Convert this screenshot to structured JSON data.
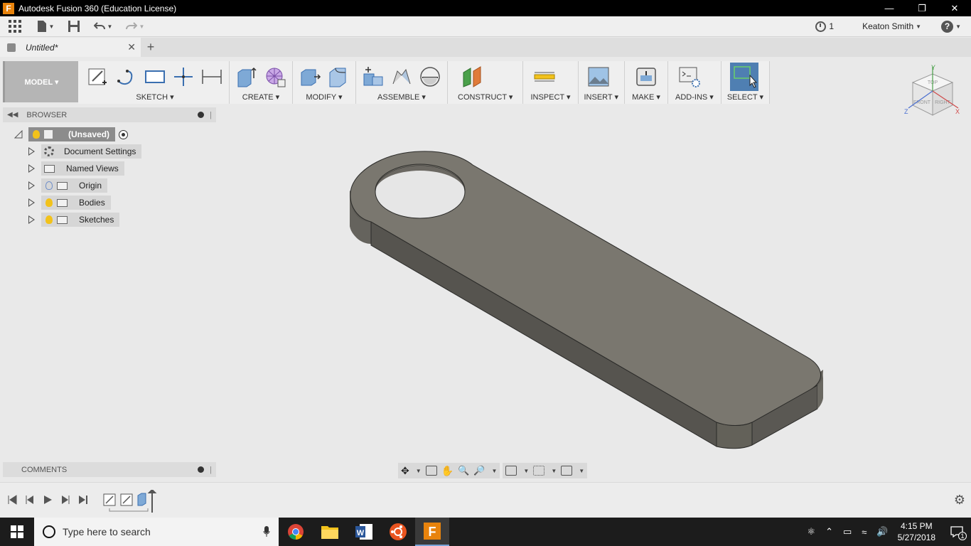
{
  "window": {
    "title": "Autodesk Fusion 360 (Education License)",
    "app_icon": "F"
  },
  "quick_access": {
    "job_count": "1",
    "user": "Keaton Smith",
    "help": "?"
  },
  "tabs": {
    "doc_title": "Untitled*"
  },
  "toolbar": {
    "workspace": "MODEL ▾",
    "groups": [
      {
        "label": "SKETCH ▾"
      },
      {
        "label": "CREATE ▾"
      },
      {
        "label": "MODIFY ▾"
      },
      {
        "label": "ASSEMBLE ▾"
      },
      {
        "label": "CONSTRUCT ▾"
      },
      {
        "label": "INSPECT ▾"
      },
      {
        "label": "INSERT ▾"
      },
      {
        "label": "MAKE ▾"
      },
      {
        "label": "ADD-INS ▾"
      },
      {
        "label": "SELECT ▾"
      }
    ]
  },
  "browser": {
    "title": "BROWSER",
    "root": "(Unsaved)",
    "items": [
      {
        "label": "Document Settings"
      },
      {
        "label": "Named Views"
      },
      {
        "label": "Origin"
      },
      {
        "label": "Bodies"
      },
      {
        "label": "Sketches"
      }
    ]
  },
  "comments": {
    "title": "COMMENTS"
  },
  "viewcube": {
    "top": "TOP",
    "front": "FRONT",
    "right": "RIGHT",
    "x": "X",
    "y": "Y",
    "z": "Z"
  },
  "taskbar": {
    "search_placeholder": "Type here to search",
    "time": "4:15 PM",
    "date": "5/27/2018",
    "notifications": "1"
  },
  "colors": {
    "model_top": "#7a776f",
    "model_side": "#5f5d57",
    "accent": "#4f7fb2"
  }
}
